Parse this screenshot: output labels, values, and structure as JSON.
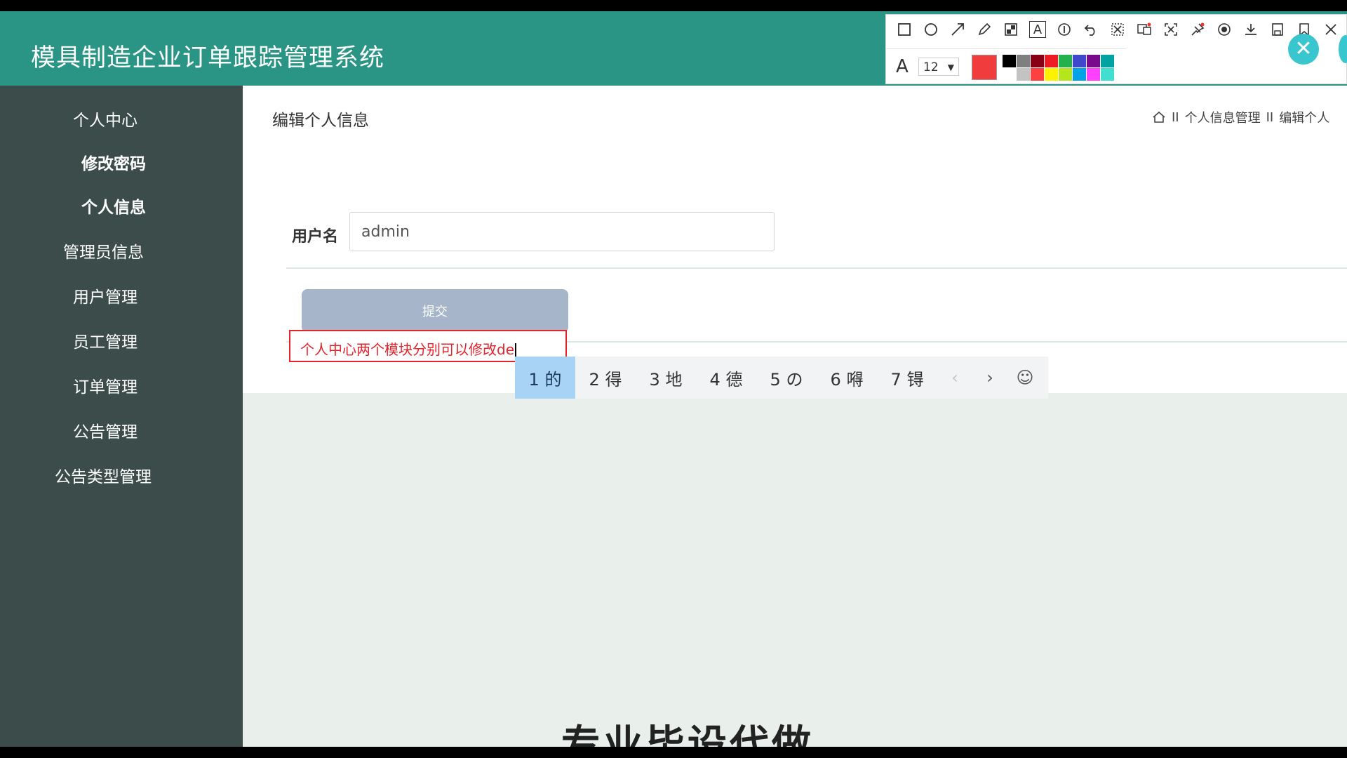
{
  "header": {
    "title": "模具制造企业订单跟踪管理系统"
  },
  "sidebar": {
    "items": [
      {
        "label": "个人中心",
        "bold": false
      },
      {
        "label": "修改密码",
        "bold": true
      },
      {
        "label": "个人信息",
        "bold": true
      },
      {
        "label": "管理员信息",
        "bold": false
      },
      {
        "label": "用户管理",
        "bold": false
      },
      {
        "label": "员工管理",
        "bold": false
      },
      {
        "label": "订单管理",
        "bold": false
      },
      {
        "label": "公告管理",
        "bold": false
      },
      {
        "label": "公告类型管理",
        "bold": false
      }
    ]
  },
  "page": {
    "title": "编辑个人信息",
    "breadcrumb": [
      "个人信息管理",
      "编辑个人"
    ],
    "breadcrumb_sep": "II"
  },
  "form": {
    "username_label": "用户名",
    "username_value": "admin",
    "submit_label": "提交"
  },
  "annotation": {
    "text": "个人中心两个模块分别可以修改de"
  },
  "ime": {
    "candidates": [
      {
        "label": "1 的",
        "selected": true
      },
      {
        "label": "2 得",
        "selected": false
      },
      {
        "label": "3 地",
        "selected": false
      },
      {
        "label": "4 德",
        "selected": false
      },
      {
        "label": "5 の",
        "selected": false
      },
      {
        "label": "6 嘚",
        "selected": false
      },
      {
        "label": "7 锝",
        "selected": false
      }
    ],
    "prev_icon": "‹",
    "next_icon": "›",
    "emoji_icon": "☺"
  },
  "toolbar": {
    "font_size": "12",
    "current_color": "#f03c3c",
    "palette_colors": [
      "#000000",
      "#7f7f7f",
      "#880015",
      "#ed1c24",
      "#22b14c",
      "#3f48cc",
      "#7a0a8c",
      "#00a2a2",
      "#ffffff",
      "#c3c3c3",
      "#ff4040",
      "#fff200",
      "#b5e61d",
      "#00a2e8",
      "#ff40ff",
      "#40e0d0"
    ],
    "close_icon": "✕"
  },
  "watermark": {
    "text": "专业毕设代做"
  }
}
